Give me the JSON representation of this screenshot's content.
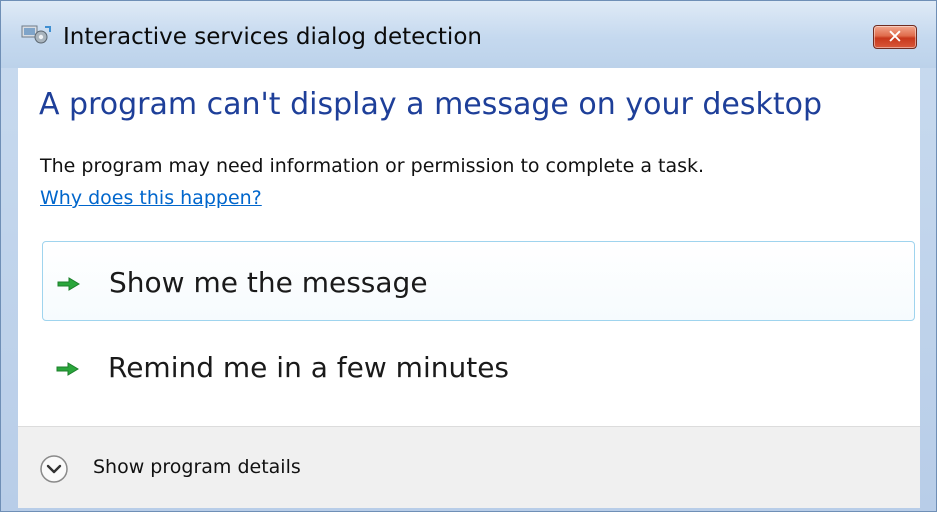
{
  "window": {
    "title": "Interactive services dialog detection",
    "title_icon": "interactive-services-icon",
    "close_symbol": "✕"
  },
  "main": {
    "heading": "A program can't display a message on your desktop",
    "description": "The program may need information or permission to complete a task.",
    "help_link": "Why does this happen?",
    "options": [
      {
        "label": "Show me the message",
        "icon": "green-arrow-icon",
        "hovered": true
      },
      {
        "label": "Remind me in a few minutes",
        "icon": "green-arrow-icon",
        "hovered": false
      }
    ]
  },
  "footer": {
    "details_label": "Show program details",
    "details_icon": "chevron-down-circle-icon"
  },
  "colors": {
    "heading": "#1e3f99",
    "link": "#0066cc",
    "arrow": "#2aa63b",
    "close": "#c7381c"
  }
}
